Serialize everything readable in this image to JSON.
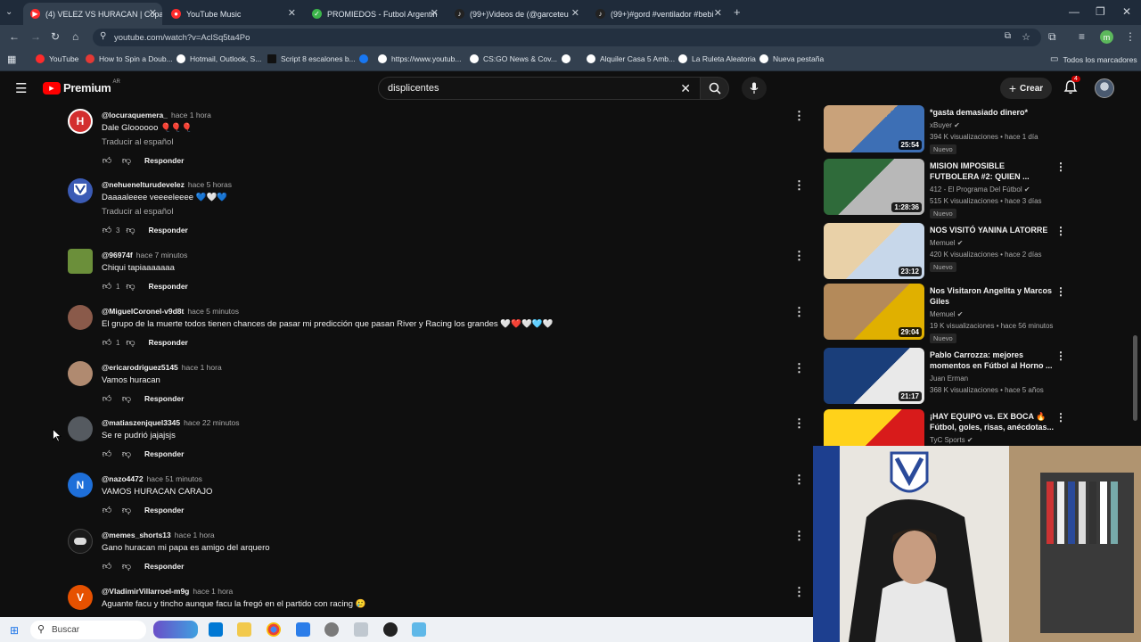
{
  "browser": {
    "tabs": [
      {
        "label": "(4) VELEZ VS HURACAN | Copa",
        "color": "#ff2b2b",
        "active": true
      },
      {
        "label": "YouTube Music",
        "color": "#ff2b2b"
      },
      {
        "label": "PROMIEDOS - Futbol Argentin",
        "color": "#3bb54a"
      },
      {
        "label": "(99+)Videos de (@garceteu",
        "color": "#222222"
      },
      {
        "label": "(99+)#gord #ventilador #bebi",
        "color": "#222222"
      }
    ],
    "new_tab": "+",
    "url": "youtube.com/watch?v=AclSq5ta4Po",
    "bookmarks": [
      {
        "label": "YouTube",
        "color": "#ff2b2b"
      },
      {
        "label": "How to Spin a Doub...",
        "color": "#e53935"
      },
      {
        "label": "Hotmail, Outlook, S...",
        "color": "#ffffff"
      },
      {
        "label": "Script 8 escalones b...",
        "color": "#111111"
      },
      {
        "label": "",
        "color": "#1877f2"
      },
      {
        "label": "https://www.youtub...",
        "color": "#ffffff"
      },
      {
        "label": "CS:GO News & Cov...",
        "color": "#ffffff"
      },
      {
        "label": "",
        "color": "#ffffff"
      },
      {
        "label": "Alquiler Casa 5 Amb...",
        "color": "#ffffff"
      },
      {
        "label": "La Ruleta Aleatoria",
        "color": "#ffffff"
      },
      {
        "label": "Nueva pestaña",
        "color": "#ffffff"
      }
    ],
    "all_bookmarks": "Todos los marcadores",
    "profile_initial": "m"
  },
  "youtube": {
    "logo_text": "Premium",
    "logo_region": "AR",
    "search_value": "displicentes",
    "create_label": "Crear",
    "notifications_count": "4"
  },
  "comments": [
    {
      "author": "@locuraquemera_",
      "time": "hace 1 hora",
      "text": "Dale Gloooooo 🎈🎈🎈",
      "translate": "Traducir al español",
      "likes": "",
      "reply": "Responder",
      "avatar_color": "#d32f2f",
      "avatar_letter": "H"
    },
    {
      "author": "@nehuenelturudevelez",
      "time": "hace 5 horas",
      "text": "Daaaaleeee veeeeleeee 💙🤍💙",
      "translate": "Traducir al español",
      "likes": "3",
      "reply": "Responder",
      "avatar_color": "#3b5bb5",
      "avatar_letter": ""
    },
    {
      "author": "@96974f",
      "time": "hace 7 minutos",
      "text": "Chiqui tapiaaaaaaa",
      "translate": "",
      "likes": "1",
      "reply": "Responder",
      "avatar_color": "#6b8f3a",
      "avatar_letter": ""
    },
    {
      "author": "@MiguelCoronel-v9d8t",
      "time": "hace 5 minutos",
      "text": "El grupo de la muerte todos tienen chances de pasar mi predicción que pasan River y Racing los grandes 🤍❤️🤍🩵🤍",
      "translate": "",
      "likes": "1",
      "reply": "Responder",
      "avatar_color": "#8a5a4a",
      "avatar_letter": ""
    },
    {
      "author": "@ericarodriguez5145",
      "time": "hace 1 hora",
      "text": "Vamos huracan",
      "translate": "",
      "likes": "",
      "reply": "Responder",
      "avatar_color": "#b08a70",
      "avatar_letter": ""
    },
    {
      "author": "@matiaszenjquel3345",
      "time": "hace 22 minutos",
      "text": "Se re pudrió jajajsjs",
      "translate": "",
      "likes": "",
      "reply": "Responder",
      "avatar_color": "#555a60",
      "avatar_letter": ""
    },
    {
      "author": "@nazo4472",
      "time": "hace 51 minutos",
      "text": "VAMOS HURACAN CARAJO",
      "translate": "",
      "likes": "",
      "reply": "Responder",
      "avatar_color": "#1e6fd9",
      "avatar_letter": "N"
    },
    {
      "author": "@memes_shorts13",
      "time": "hace 1 hora",
      "text": "Gano huracan mi papa es amigo del arquero",
      "translate": "",
      "likes": "",
      "reply": "Responder",
      "avatar_color": "#222222",
      "avatar_letter": ""
    },
    {
      "author": "@VladimirVillarroel-m9g",
      "time": "hace 1 hora",
      "text": "Aguante facu y tincho aunque facu la fregó en el partido con racing 🥲",
      "translate": "",
      "likes": "",
      "reply": "",
      "avatar_color": "#e65100",
      "avatar_letter": "V"
    }
  ],
  "recommendations": [
    {
      "title": "*gasta demasiado dinero*",
      "channel": "xBuyer",
      "meta": "394 K visualizaciones • hace 1 día",
      "badge": "Nuevo",
      "duration": "25:54",
      "thumb_colors": [
        "#c9a27a",
        "#3d6fb5"
      ]
    },
    {
      "title": "MISION IMPOSIBLE FUTBOLERA #2: QUIEN ...",
      "channel": "412 - El Programa Del Fútbol",
      "meta": "515 K visualizaciones • hace 3 días",
      "badge": "Nuevo",
      "duration": "1:28:36",
      "thumb_colors": [
        "#2f6b3a",
        "#b8b8b8"
      ]
    },
    {
      "title": "NOS VISITÓ YANINA LATORRE",
      "channel": "Memuel",
      "meta": "420 K visualizaciones • hace 2 días",
      "badge": "Nuevo",
      "duration": "23:12",
      "thumb_colors": [
        "#e9d1a8",
        "#c7d7ea"
      ]
    },
    {
      "title": "Nos Visitaron Angelita y Marcos Giles",
      "channel": "Memuel",
      "meta": "19 K visualizaciones • hace 56 minutos",
      "badge": "Nuevo",
      "duration": "29:04",
      "thumb_colors": [
        "#b48a5a",
        "#e0b000"
      ]
    },
    {
      "title": "Pablo Carrozza: mejores momentos en Fútbol al Horno ...",
      "channel": "Juan Erman",
      "meta": "368 K visualizaciones • hace 5 años",
      "badge": "",
      "duration": "21:17",
      "thumb_colors": [
        "#1a3e7a",
        "#e9e9e9"
      ]
    },
    {
      "title": "¡HAY EQUIPO vs. EX BOCA 🔥 Fútbol, goles, risas, anécdotas...",
      "channel": "TyC Sports",
      "meta": "",
      "badge": "",
      "duration": "",
      "thumb_colors": [
        "#ffd21a",
        "#d81b1b"
      ]
    }
  ],
  "taskbar": {
    "search_label": "Buscar"
  }
}
